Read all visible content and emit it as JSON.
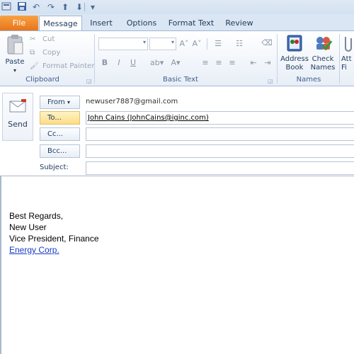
{
  "quick_access": {
    "icons": [
      "app-icon",
      "save-icon",
      "undo-icon",
      "redo-icon",
      "up-icon",
      "down-icon",
      "customize-icon"
    ]
  },
  "tabs": [
    {
      "label": "File"
    },
    {
      "label": "Message"
    },
    {
      "label": "Insert"
    },
    {
      "label": "Options"
    },
    {
      "label": "Format Text"
    },
    {
      "label": "Review"
    }
  ],
  "clipboard": {
    "paste_label": "Paste",
    "cut_label": "Cut",
    "copy_label": "Copy",
    "format_painter_label": "Format Painter",
    "group_label": "Clipboard"
  },
  "basic_text": {
    "group_label": "Basic Text",
    "bold": "B",
    "italic": "I",
    "underline": "U"
  },
  "names": {
    "group_label": "Names",
    "address_book_line1": "Address",
    "address_book_line2": "Book",
    "check_names_line1": "Check",
    "check_names_line2": "Names",
    "attach_line1": "Att",
    "attach_line2": "Fi"
  },
  "header": {
    "send_label": "Send",
    "from_label": "From",
    "from_value": "newuser7887@gmail.com",
    "to_label": "To...",
    "to_value": "John Cains (JohnCains@iginc.com)",
    "cc_label": "Cc...",
    "cc_value": "",
    "bcc_label": "Bcc...",
    "bcc_value": "",
    "subject_label": "Subject:",
    "subject_value": ""
  },
  "body": {
    "line1": "Best Regards,",
    "line2": "New User",
    "line3": "Vice President, Finance",
    "company": "Energy Corp."
  },
  "colors": {
    "file_tab": "#e9741a",
    "ribbon_bg": "#e8eef7",
    "to_button": "#fbdd85",
    "link": "#1a3cc7"
  }
}
